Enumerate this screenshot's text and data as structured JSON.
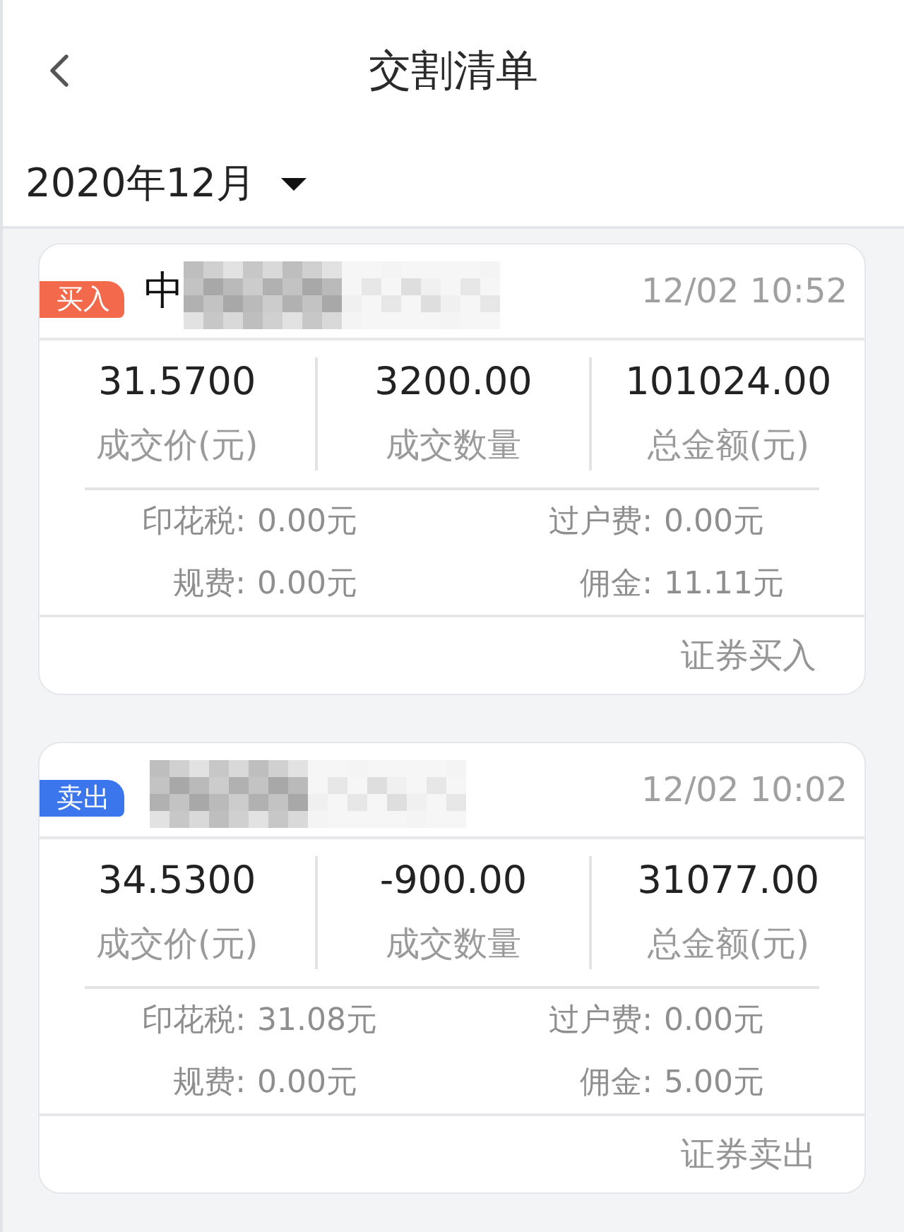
{
  "header": {
    "title": "交割清单"
  },
  "period": {
    "label": "2020年12月"
  },
  "trades": [
    {
      "badge": "买入",
      "color": "#f2694b",
      "name": "中",
      "time": "12/02 10:52",
      "stats": [
        {
          "value": "31.5700",
          "label": "成交价(元)"
        },
        {
          "value": "3200.00",
          "label": "成交数量"
        },
        {
          "value": "101024.00",
          "label": "总金额(元)"
        }
      ],
      "fees": [
        {
          "label": "印花税:",
          "value": "0.00元"
        },
        {
          "label": "过户费:",
          "value": "0.00元"
        },
        {
          "label": "规费:",
          "value": "0.00元"
        },
        {
          "label": "佣金:",
          "value": "11.11元"
        }
      ],
      "type": "证券买入"
    },
    {
      "badge": "卖出",
      "color": "#3b76ec",
      "time": "12/02 10:02",
      "stats": [
        {
          "value": "34.5300",
          "label": "成交价(元)"
        },
        {
          "value": "-900.00",
          "label": "成交数量"
        },
        {
          "value": "31077.00",
          "label": "总金额(元)"
        }
      ],
      "fees": [
        {
          "label": "印花税:",
          "value": "31.08元"
        },
        {
          "label": "过户费:",
          "value": "0.00元"
        },
        {
          "label": "规费:",
          "value": "0.00元"
        },
        {
          "label": "佣金:",
          "value": "5.00元"
        }
      ],
      "type": "证券卖出"
    }
  ]
}
